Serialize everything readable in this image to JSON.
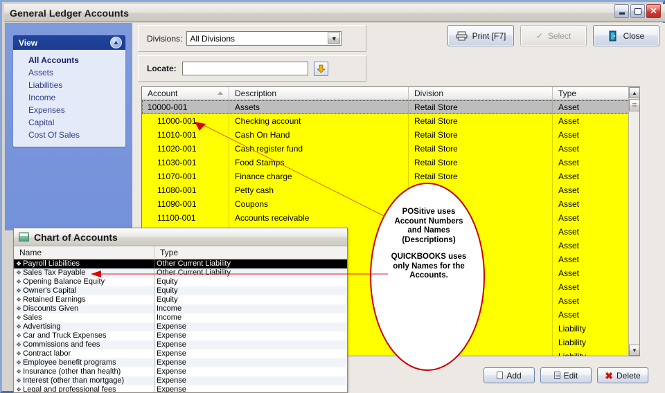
{
  "window": {
    "title": "General Ledger Accounts",
    "controls": {
      "minimize": "minimize-button",
      "maximize": "maximize-button",
      "close": "close-button"
    }
  },
  "sidebar": {
    "panel_title": "View",
    "collapse_glyph": "«",
    "items": [
      {
        "label": "All Accounts",
        "active": true
      },
      {
        "label": "Assets",
        "active": false
      },
      {
        "label": "Liabilities",
        "active": false
      },
      {
        "label": "Income",
        "active": false
      },
      {
        "label": "Expenses",
        "active": false
      },
      {
        "label": "Capital",
        "active": false
      },
      {
        "label": "Cost Of Sales",
        "active": false
      }
    ]
  },
  "filters": {
    "divisions_label": "Divisions:",
    "divisions_value": "All Divisions",
    "divisions_arrow": "▼",
    "locate_label": "Locate:",
    "locate_value": "",
    "locate_placeholder": "",
    "locate_go_glyph": "➦"
  },
  "toolbar": {
    "print_label": "Print [F7]",
    "select_label": "Select",
    "close_label": "Close",
    "select_check": "✓",
    "close_glyph": "⏻"
  },
  "grid": {
    "columns": [
      "Account",
      "Description",
      "Division",
      "Type"
    ],
    "sorted_column": "Account",
    "highlight_color": "#ffff00",
    "rows": [
      {
        "account": "10000-001",
        "description": "Assets",
        "division": "Retail Store",
        "type": "Asset",
        "selected": true,
        "indent": false
      },
      {
        "account": "11000-001",
        "description": "Checking account",
        "division": "Retail Store",
        "type": "Asset",
        "selected": false,
        "indent": true
      },
      {
        "account": "11010-001",
        "description": "Cash On Hand",
        "division": "Retail Store",
        "type": "Asset",
        "selected": false,
        "indent": true
      },
      {
        "account": "11020-001",
        "description": "Cash register fund",
        "division": "Retail Store",
        "type": "Asset",
        "selected": false,
        "indent": true
      },
      {
        "account": "11030-001",
        "description": "Food Stamps",
        "division": "Retail Store",
        "type": "Asset",
        "selected": false,
        "indent": true
      },
      {
        "account": "11070-001",
        "description": "Finance charge",
        "division": "Retail Store",
        "type": "Asset",
        "selected": false,
        "indent": true
      },
      {
        "account": "11080-001",
        "description": "Petty cash",
        "division": "",
        "type": "Asset",
        "selected": false,
        "indent": true
      },
      {
        "account": "11090-001",
        "description": "Coupons",
        "division": "",
        "type": "Asset",
        "selected": false,
        "indent": true
      },
      {
        "account": "11100-001",
        "description": "Accounts receivable",
        "division": "",
        "type": "Asset",
        "selected": false,
        "indent": true
      },
      {
        "account": "",
        "description": "",
        "division": "",
        "type": "Asset",
        "selected": false,
        "indent": true
      },
      {
        "account": "",
        "description": "",
        "division": "",
        "type": "Asset",
        "selected": false,
        "indent": true
      },
      {
        "account": "",
        "description": "",
        "division": "",
        "type": "Asset",
        "selected": false,
        "indent": true
      },
      {
        "account": "",
        "description": "",
        "division": "",
        "type": "Asset",
        "selected": false,
        "indent": true
      },
      {
        "account": "",
        "description": "",
        "division": "",
        "type": "Asset",
        "selected": false,
        "indent": true
      },
      {
        "account": "",
        "description": "",
        "division": "",
        "type": "Asset",
        "selected": false,
        "indent": true
      },
      {
        "account": "",
        "description": "",
        "division": "",
        "type": "Asset",
        "selected": false,
        "indent": true
      },
      {
        "account": "",
        "description": "",
        "division": "",
        "type": "Liability",
        "selected": false,
        "indent": true
      },
      {
        "account": "",
        "description": "",
        "division": "",
        "type": "Liability",
        "selected": false,
        "indent": true
      },
      {
        "account": "",
        "description": "",
        "division": "",
        "type": "Liability",
        "selected": false,
        "indent": true
      }
    ],
    "scrollbar": {
      "up": "▲",
      "down": "▼"
    }
  },
  "actions": {
    "add_label": "Add",
    "edit_label": "Edit",
    "delete_label": "Delete",
    "delete_glyph": "✖"
  },
  "chart_of_accounts": {
    "title": "Chart of Accounts",
    "columns": [
      "Name",
      "Type"
    ],
    "bullet": "❖",
    "rows": [
      {
        "name": "Payroll Liabilities",
        "type": "Other Current Liability",
        "selected": true
      },
      {
        "name": "Sales Tax Payable",
        "type": "Other Current Liability",
        "selected": false
      },
      {
        "name": "Opening Balance Equity",
        "type": "Equity",
        "selected": false
      },
      {
        "name": "Owner's Capital",
        "type": "Equity",
        "selected": false
      },
      {
        "name": "Retained Earnings",
        "type": "Equity",
        "selected": false
      },
      {
        "name": "Discounts Given",
        "type": "Income",
        "selected": false
      },
      {
        "name": "Sales",
        "type": "Income",
        "selected": false
      },
      {
        "name": "Advertising",
        "type": "Expense",
        "selected": false
      },
      {
        "name": "Car and Truck Expenses",
        "type": "Expense",
        "selected": false
      },
      {
        "name": "Commissions and fees",
        "type": "Expense",
        "selected": false
      },
      {
        "name": "Contract labor",
        "type": "Expense",
        "selected": false
      },
      {
        "name": "Employee benefit programs",
        "type": "Expense",
        "selected": false
      },
      {
        "name": "Insurance (other than health)",
        "type": "Expense",
        "selected": false
      },
      {
        "name": "Interest (other than mortgage)",
        "type": "Expense",
        "selected": false
      },
      {
        "name": "Legal and professional fees",
        "type": "Expense",
        "selected": false
      }
    ]
  },
  "annotation": {
    "paragraph1_line1": "POSitive uses",
    "paragraph1_line2": "Account Numbers",
    "paragraph1_line3": "and Names",
    "paragraph1_line4": "(Descriptions)",
    "paragraph2_line1": "QUICKBOOKS uses",
    "paragraph2_line2": "only Names for the",
    "paragraph2_line3": "Accounts.",
    "ellipse_color": "#cc0000",
    "leader_color": "#d94f1e",
    "arrow_color": "#dd0000"
  }
}
